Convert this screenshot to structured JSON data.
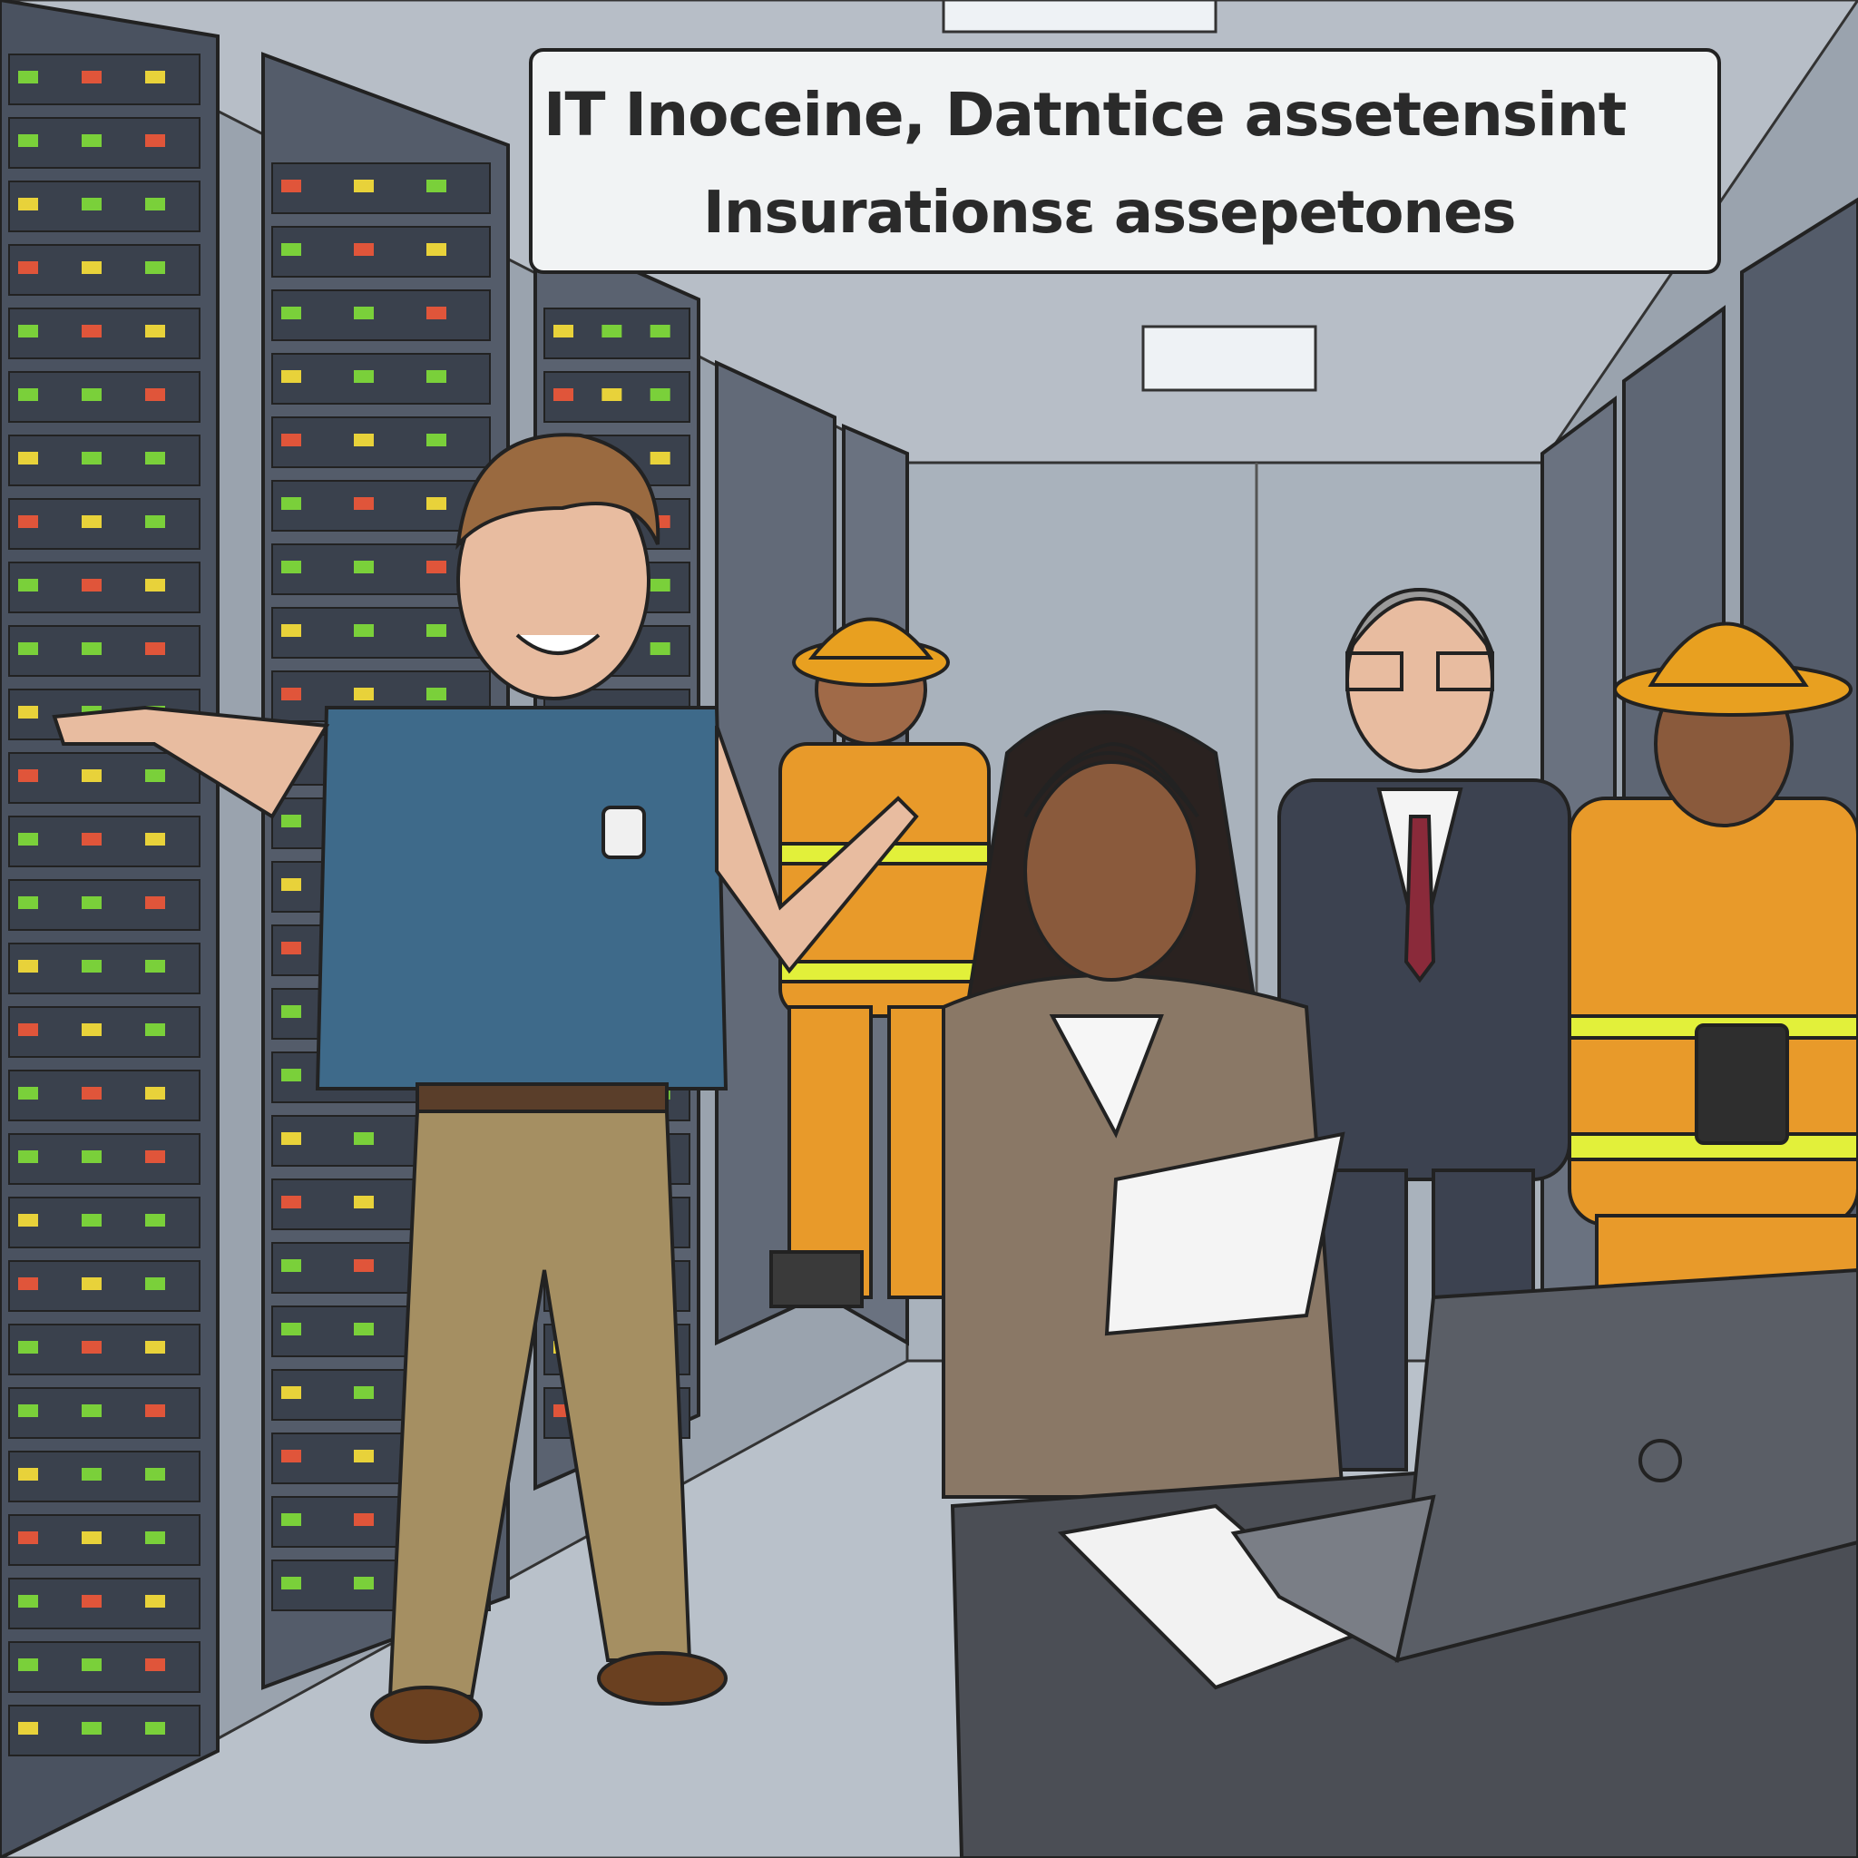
{
  "banner": {
    "line1": "IT Inoceine, Datntice assetensint",
    "line2": "Insurationsɛ assepetones"
  },
  "colors": {
    "wall": "#9aa3ae",
    "rack": "#4a5260",
    "led_green": "#7ad03a",
    "led_red": "#e0553a",
    "led_yellow": "#e8d23a",
    "firefighter": "#e89a2a",
    "reflective": "#e2f03a",
    "polo": "#3e6a8a",
    "khaki": "#a58f62",
    "suit": "#3c4250",
    "blazer": "#8a7866",
    "desk": "#4b4e55"
  }
}
